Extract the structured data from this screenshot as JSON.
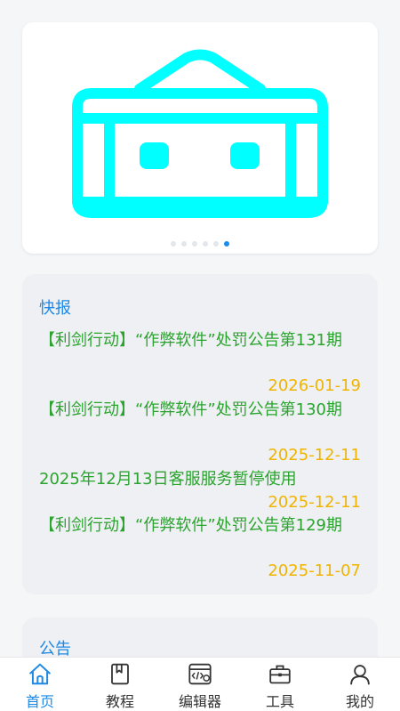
{
  "banner": {
    "image": "cyan-robot-illustration",
    "dots": [
      false,
      false,
      false,
      false,
      false,
      true
    ]
  },
  "news": {
    "title": "快报",
    "items": [
      {
        "text": "【利剑行动】“作弊软件”处罚公告第131期",
        "date": "2026-01-19"
      },
      {
        "text": "【利剑行动】“作弊软件”处罚公告第130期",
        "date": "2025-12-11"
      },
      {
        "text": "2025年12月13日客服服务暂停使用",
        "date": "2025-12-11"
      },
      {
        "text": "【利剑行动】“作弊软件”处罚公告第129期",
        "date": "2025-11-07"
      }
    ]
  },
  "notice": {
    "title": "公告"
  },
  "tabbar": {
    "items": [
      {
        "label": "首页",
        "icon": "home-icon",
        "active": true
      },
      {
        "label": "教程",
        "icon": "book-icon",
        "active": false
      },
      {
        "label": "编辑器",
        "icon": "code-editor-icon",
        "active": false
      },
      {
        "label": "工具",
        "icon": "toolbox-icon",
        "active": false
      },
      {
        "label": "我的",
        "icon": "user-icon",
        "active": false
      }
    ]
  },
  "colors": {
    "accent": "#1e88e5",
    "news_text": "#2aa42e",
    "news_date": "#f0b400",
    "robot": "#00ffff"
  }
}
